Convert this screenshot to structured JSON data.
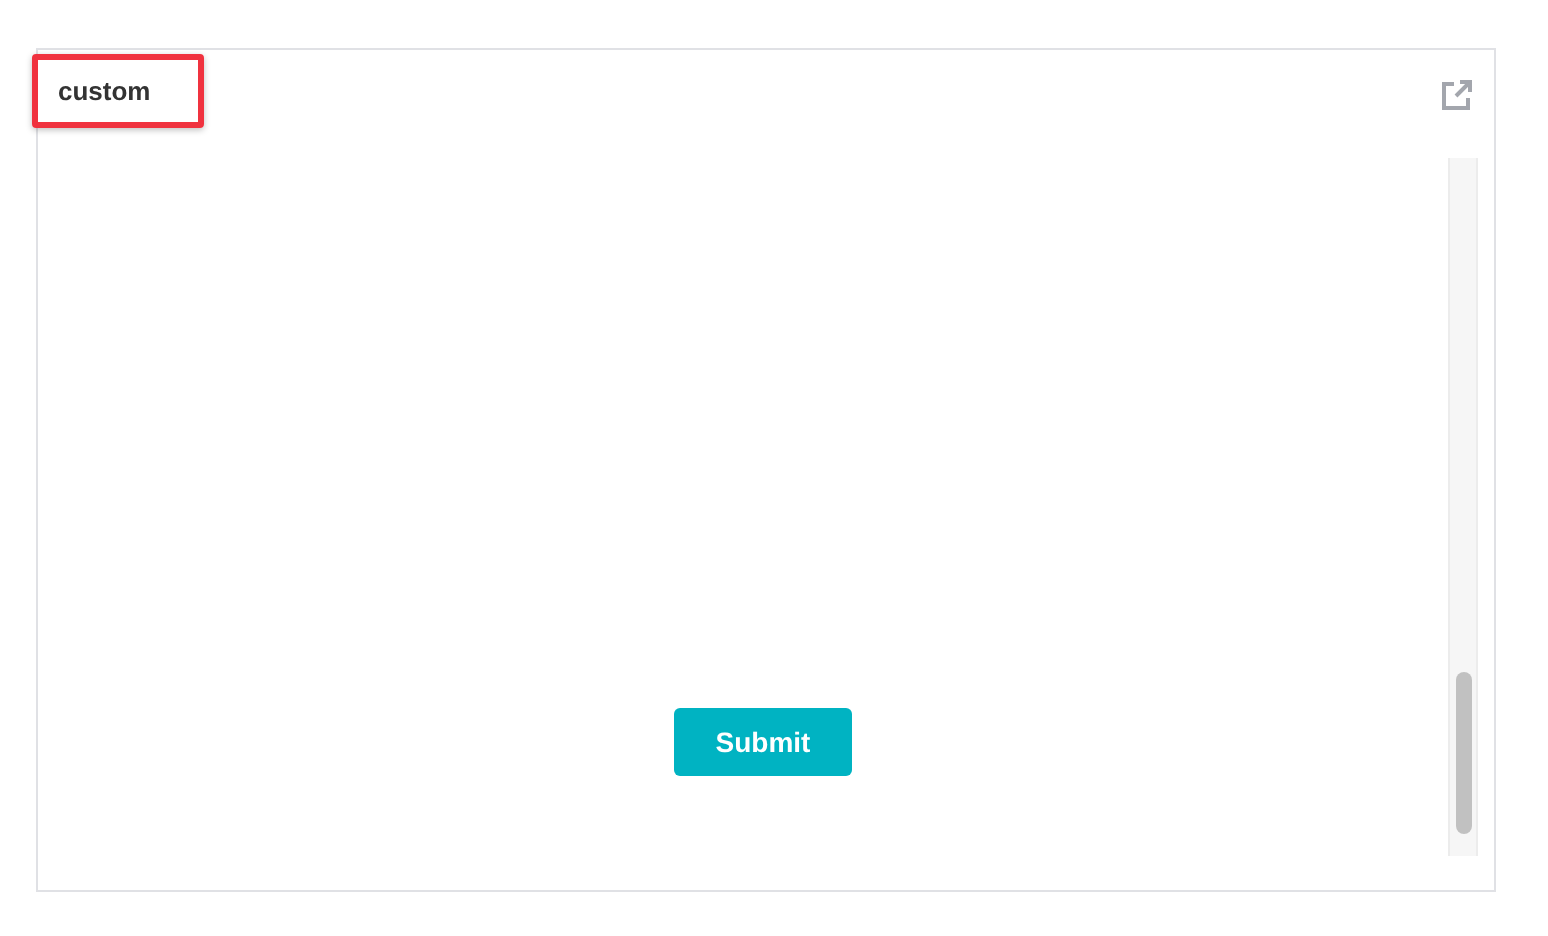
{
  "panel": {
    "title": "custom",
    "title_highlighted": true
  },
  "form": {
    "submit_button": "Submit"
  }
}
